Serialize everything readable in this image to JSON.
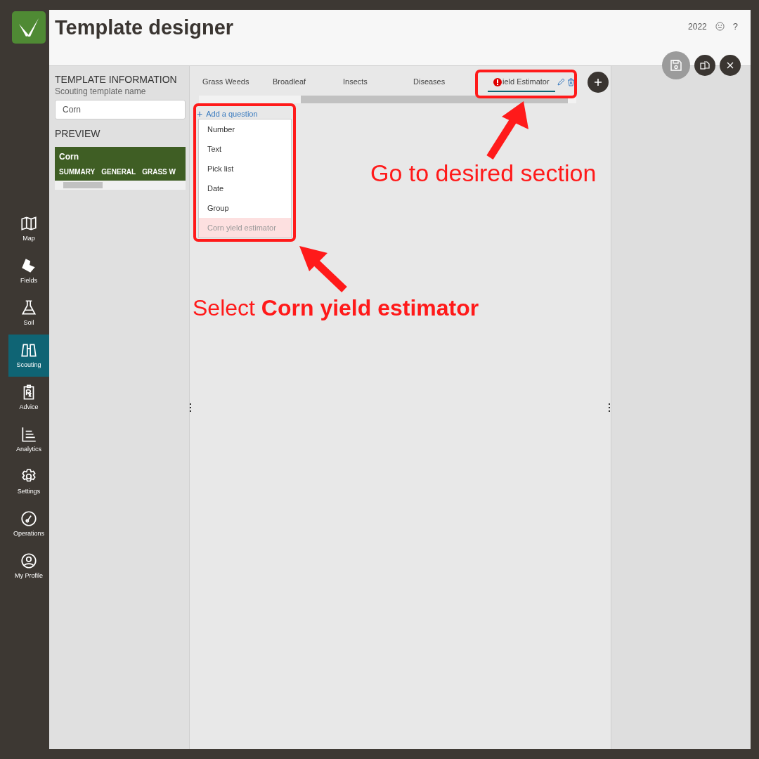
{
  "header": {
    "title": "Template designer",
    "year": "2022",
    "help": "?"
  },
  "nav": [
    {
      "label": "Map",
      "selected": false
    },
    {
      "label": "Fields",
      "selected": false
    },
    {
      "label": "Soil",
      "selected": false
    },
    {
      "label": "Scouting",
      "selected": true
    },
    {
      "label": "Advice",
      "selected": false
    },
    {
      "label": "Analytics",
      "selected": false
    },
    {
      "label": "Settings",
      "selected": false
    },
    {
      "label": "Operations",
      "selected": false
    },
    {
      "label": "My Profile",
      "selected": false
    }
  ],
  "template_info": {
    "heading": "TEMPLATE INFORMATION",
    "name_label": "Scouting template name",
    "name_value": "Corn",
    "preview_heading": "PREVIEW"
  },
  "preview": {
    "title": "Corn",
    "sections": [
      "SUMMARY",
      "GENERAL",
      "GRASS W"
    ]
  },
  "tabs": [
    {
      "label": "Grass Weeds",
      "selected": false,
      "error": false
    },
    {
      "label": "Broadleaf",
      "selected": false,
      "error": false
    },
    {
      "label": "Insects",
      "selected": false,
      "error": false
    },
    {
      "label": "Diseases",
      "selected": false,
      "error": false
    },
    {
      "label": "ield Estimator",
      "selected": true,
      "error": true
    }
  ],
  "add_question": {
    "label": "Add a question",
    "plus": "+"
  },
  "question_types": [
    {
      "label": "Number",
      "highlighted": false
    },
    {
      "label": "Text",
      "highlighted": false
    },
    {
      "label": "Pick list",
      "highlighted": false
    },
    {
      "label": "Date",
      "highlighted": false
    },
    {
      "label": "Group",
      "highlighted": false
    },
    {
      "label": "Corn yield estimator",
      "highlighted": true
    }
  ],
  "annotations": [
    {
      "text": "Go to desired section"
    },
    {
      "text": "Select **Corn yield estimator**"
    }
  ]
}
